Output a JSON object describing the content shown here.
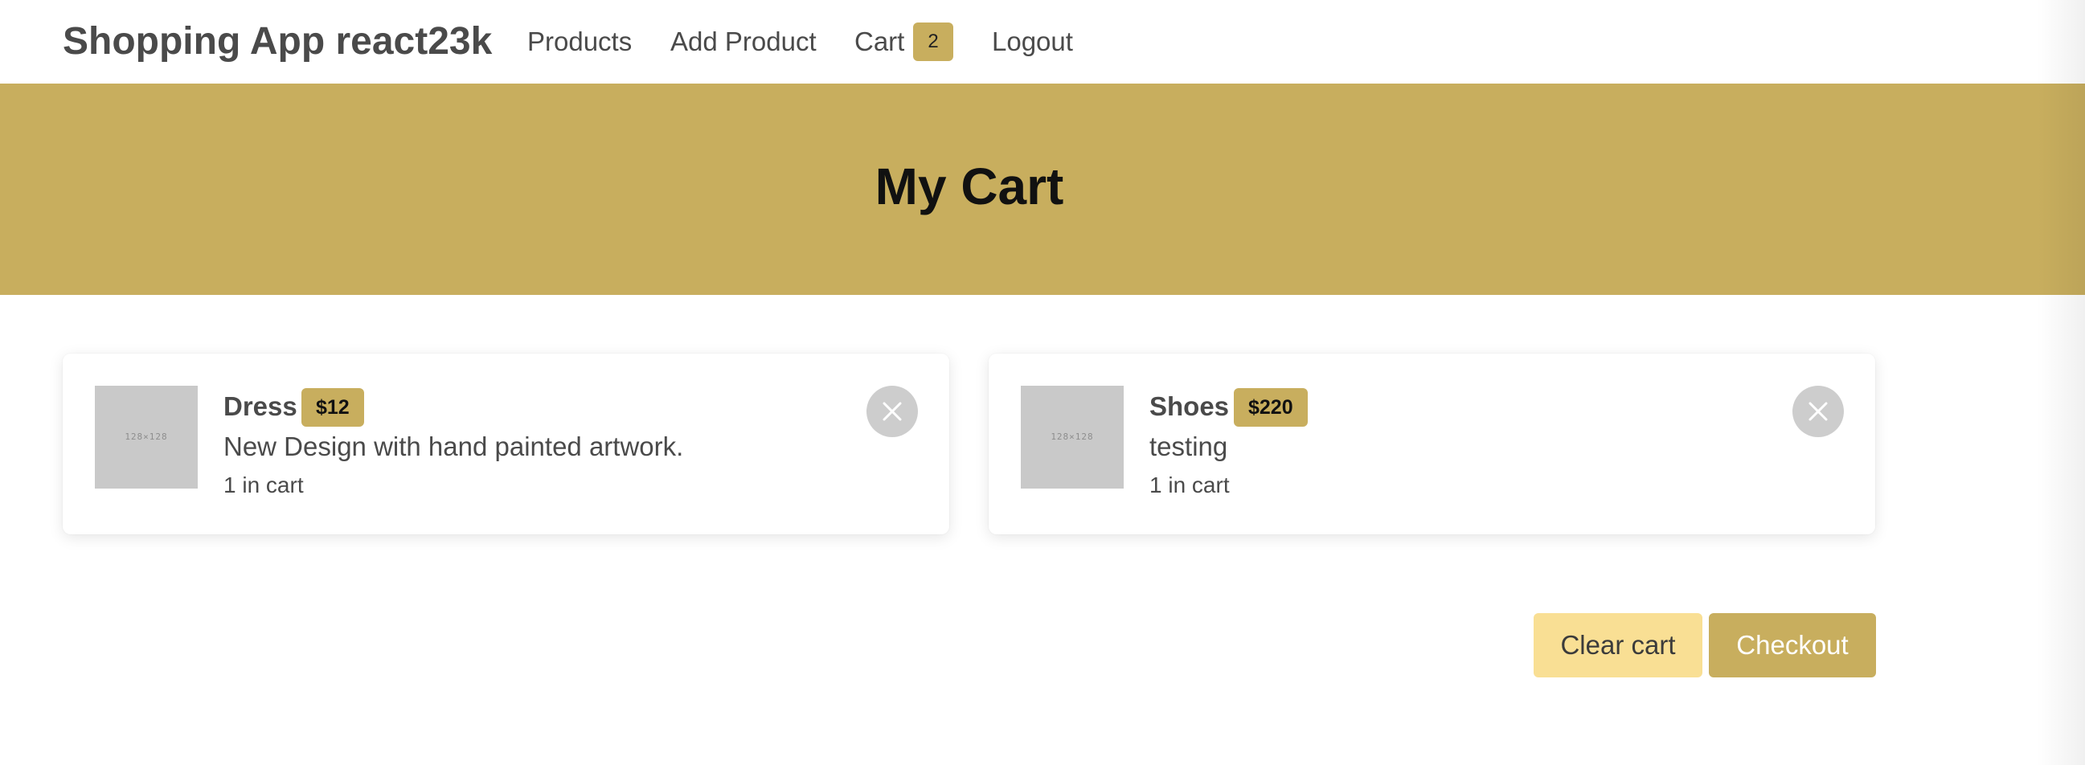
{
  "navbar": {
    "brand": "Shopping App react23k",
    "links": {
      "products": "Products",
      "add_product": "Add Product",
      "cart": "Cart",
      "logout": "Logout"
    },
    "cart_count": "2"
  },
  "hero": {
    "title": "My Cart"
  },
  "cart": {
    "items": [
      {
        "name": "Dress",
        "price": "$12",
        "description": "New Design with hand painted artwork.",
        "quantity": "1 in cart",
        "image_label": "128×128",
        "remove_icon": "close-icon"
      },
      {
        "name": "Shoes",
        "price": "$220",
        "description": "testing",
        "quantity": "1 in cart",
        "image_label": "128×128",
        "remove_icon": "close-icon"
      }
    ]
  },
  "actions": {
    "clear_cart": "Clear cart",
    "checkout": "Checkout"
  },
  "colors": {
    "accent": "#c8ae5e",
    "clear_button": "#f9df94",
    "remove_button": "#cdcdcd",
    "placeholder_image": "#c9c9c9",
    "text": "#4a4a4a"
  }
}
